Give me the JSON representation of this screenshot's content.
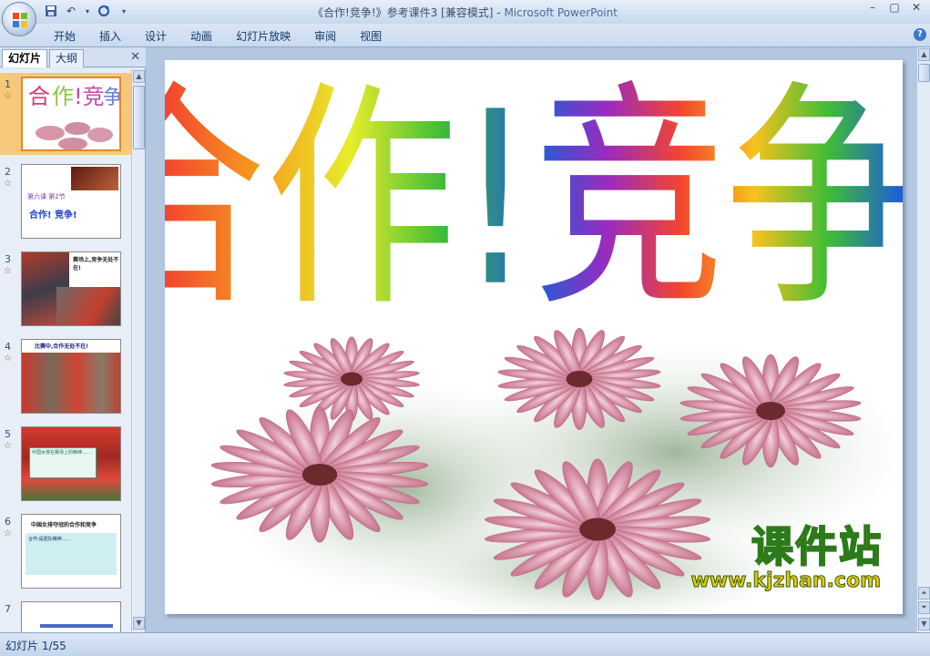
{
  "window": {
    "title_doc": "《合作!竞争!》参考课件3 [兼容模式]",
    "title_sep": " - ",
    "title_app": "Microsoft PowerPoint"
  },
  "ribbon": {
    "tabs": [
      "开始",
      "插入",
      "设计",
      "动画",
      "幻灯片放映",
      "审阅",
      "视图"
    ]
  },
  "pane": {
    "tab_slides": "幻灯片",
    "tab_outline": "大纲"
  },
  "thumbnails": [
    {
      "num": "1",
      "text": "合作!竞争!"
    },
    {
      "num": "2",
      "text": "合作! 竞争!",
      "sub": "第六课 第2节"
    },
    {
      "num": "3",
      "text": "赛场上,竞争无处不在!"
    },
    {
      "num": "4",
      "text": "比赛中,合作无处不在!"
    },
    {
      "num": "5",
      "text": "中国女排在赛场上的精神……"
    },
    {
      "num": "6",
      "text": "中国女排夺冠的合作和竞争",
      "body": "合作:是团队精神……"
    },
    {
      "num": "7",
      "text": "……"
    }
  ],
  "slide": {
    "title": "合作!竞争!"
  },
  "watermark": {
    "brand": "课件站",
    "url": "www.kjzhan.com"
  },
  "status": {
    "slide_info": "幻灯片 1/55"
  },
  "colors": {
    "ribbon_text": "#15396d",
    "active_thumb": "#f7c87b",
    "slide_bg": "#ffffff"
  }
}
